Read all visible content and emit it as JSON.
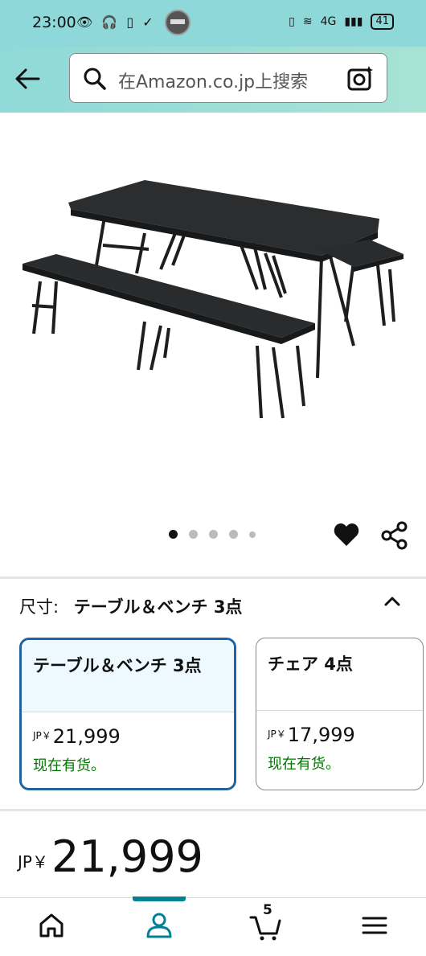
{
  "status_bar": {
    "time": "23:00",
    "battery": "41",
    "network": "4G"
  },
  "search": {
    "placeholder": "在Amazon.co.jp上搜索"
  },
  "carousel": {
    "total": 5,
    "active": 1
  },
  "size": {
    "label": "尺寸:",
    "selected": "テーブル＆ベンチ 3点",
    "options": [
      {
        "name": "テーブル＆ベンチ 3点",
        "currency": "JP￥",
        "price": "21,999",
        "stock": "现在有货。"
      },
      {
        "name": "チェア 4点",
        "currency": "JP￥",
        "price": "17,999",
        "stock": "现在有货。"
      }
    ]
  },
  "price": {
    "currency": "JP￥",
    "amount": "21,999"
  },
  "nav": {
    "cart_count": "5"
  },
  "colors": {
    "accent": "#008296",
    "selected_border": "#2162a1",
    "stock_green": "#007600",
    "header_teal": "#8ed8d9"
  }
}
